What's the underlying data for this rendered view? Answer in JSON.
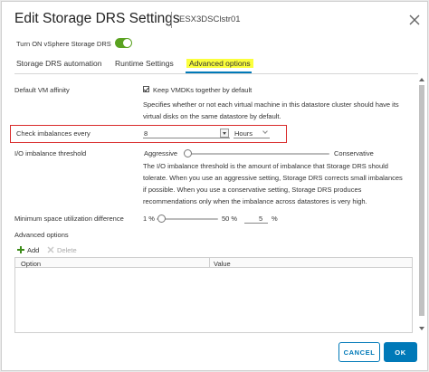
{
  "dialog": {
    "title": "Edit Storage DRS Settings",
    "host": "ESX3DSClstr01"
  },
  "toggle": {
    "label": "Turn ON vSphere Storage DRS",
    "on": true
  },
  "tabs": [
    {
      "label": "Storage DRS automation",
      "active": false
    },
    {
      "label": "Runtime Settings",
      "active": false
    },
    {
      "label": "Advanced options",
      "active": true
    }
  ],
  "settings": {
    "vm_affinity": {
      "label": "Default VM affinity",
      "checkbox_label": "Keep VMDKs together by default",
      "checked": true,
      "description_line1": "Specifies whether or not each virtual machine in this datastore cluster should have its",
      "description_line2": "virtual disks on the same datastore by default."
    },
    "check_imbalances": {
      "label": "Check imbalances every",
      "value": "8",
      "unit": "Hours"
    },
    "io_threshold": {
      "label": "I/O imbalance threshold",
      "left_label": "Aggressive",
      "right_label": "Conservative",
      "slider_fraction": 0.02,
      "desc": [
        "The I/O imbalance threshold is the amount of imbalance that Storage DRS should",
        "tolerate. When you use an aggressive setting, Storage DRS corrects small imbalances",
        "if possible. When you use a conservative setting, Storage DRS produces",
        "recommendations only when the imbalance across datastores is very high."
      ]
    },
    "min_space": {
      "label": "Minimum space utilization difference",
      "min_label": "1 %",
      "max_label": "50 %",
      "value": "5",
      "unit": "%",
      "slider_fraction": 0.08
    }
  },
  "advanced_options": {
    "label": "Advanced options",
    "add_label": "Add",
    "delete_label": "Delete",
    "columns": [
      "Option",
      "Value"
    ]
  },
  "buttons": {
    "cancel": "CANCEL",
    "ok": "OK"
  },
  "colors": {
    "accent": "#0079b8",
    "toggle_on": "#5aa220",
    "highlight_box": "#d92b2b",
    "tab_highlight": "#fbff3c"
  }
}
